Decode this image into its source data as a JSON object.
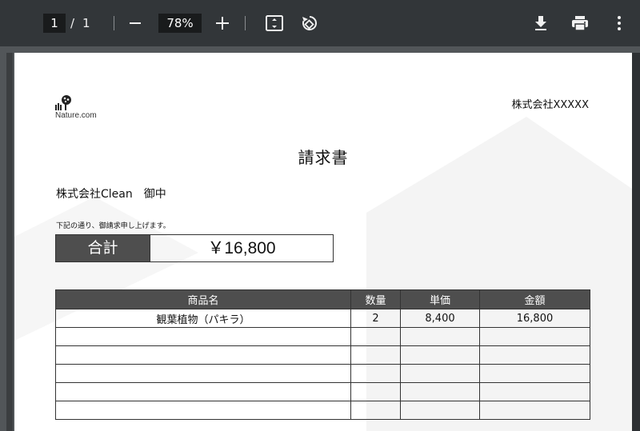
{
  "toolbar": {
    "current_page": "1",
    "page_separator": "/",
    "total_pages": "1",
    "zoom_minus_icon": "minus-icon",
    "zoom_level": "78%",
    "zoom_plus_icon": "plus-icon",
    "fit_icon": "fit-to-page-icon",
    "rotate_icon": "rotate-icon",
    "download_icon": "download-icon",
    "print_icon": "print-icon",
    "more_icon": "more-vertical-icon"
  },
  "document": {
    "logo_text": "Nature.com",
    "issuer_company": "株式会社XXXXX",
    "title": "請求書",
    "recipient": "株式会社Clean　御中",
    "note": "下記の通り、御請求申し上げます。",
    "total_label": "合計",
    "total_value": "￥16,800",
    "table": {
      "headers": [
        "商品名",
        "数量",
        "単価",
        "金額"
      ],
      "rows": [
        [
          "観葉植物（パキラ）",
          "2",
          "8,400",
          "16,800"
        ],
        [
          "",
          "",
          "",
          ""
        ],
        [
          "",
          "",
          "",
          ""
        ],
        [
          "",
          "",
          "",
          ""
        ],
        [
          "",
          "",
          "",
          ""
        ],
        [
          "",
          "",
          "",
          ""
        ]
      ]
    }
  },
  "colors": {
    "toolbar_bg": "#323639",
    "viewer_bg": "#525659",
    "table_header_bg": "#4e4e4e"
  }
}
